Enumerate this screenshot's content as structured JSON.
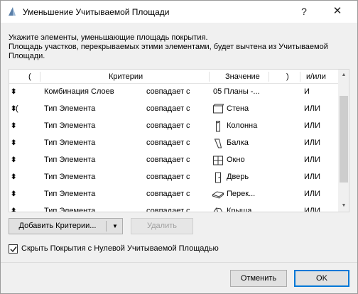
{
  "window": {
    "title": "Уменьшение Учитываемой Площади",
    "help_label": "?",
    "close_label": "✕"
  },
  "description": {
    "line1": "Укажите элементы, уменьшающие площадь покрытия.",
    "line2": "Площадь участков, перекрываемых этими элементами, будет вычтена из Учитываемой",
    "line3": "Площади."
  },
  "table": {
    "headers": {
      "open_paren": "(",
      "criteria": "Критерии",
      "value": "Значение",
      "close_paren": ")",
      "logic": "и/или"
    },
    "rows": [
      {
        "drag": "⬍",
        "paren": "",
        "criterion": "Комбинация Слоев",
        "operator": "совпадает с",
        "icon": "",
        "value": "05 Планы -...",
        "logic": "И"
      },
      {
        "drag": "⬍",
        "paren": "(",
        "criterion": "Тип Элемента",
        "operator": "совпадает с",
        "icon": "wall-icon",
        "value": "Стена",
        "logic": "ИЛИ"
      },
      {
        "drag": "⬍",
        "paren": "",
        "criterion": "Тип Элемента",
        "operator": "совпадает с",
        "icon": "column-icon",
        "value": "Колонна",
        "logic": "ИЛИ"
      },
      {
        "drag": "⬍",
        "paren": "",
        "criterion": "Тип Элемента",
        "operator": "совпадает с",
        "icon": "beam-icon",
        "value": "Балка",
        "logic": "ИЛИ"
      },
      {
        "drag": "⬍",
        "paren": "",
        "criterion": "Тип Элемента",
        "operator": "совпадает с",
        "icon": "window-icon",
        "value": "Окно",
        "logic": "ИЛИ"
      },
      {
        "drag": "⬍",
        "paren": "",
        "criterion": "Тип Элемента",
        "operator": "совпадает с",
        "icon": "door-icon",
        "value": "Дверь",
        "logic": "ИЛИ"
      },
      {
        "drag": "⬍",
        "paren": "",
        "criterion": "Тип Элемента",
        "operator": "совпадает с",
        "icon": "slab-icon",
        "value": "Перек...",
        "logic": "ИЛИ"
      },
      {
        "drag": "⬍",
        "paren": "",
        "criterion": "Тип Элемента",
        "operator": "совпадает с",
        "icon": "roof-icon",
        "value": "Крыша",
        "logic": "ИЛИ"
      },
      {
        "drag": "",
        "paren": "",
        "criterion": "",
        "operator": "",
        "icon": "shell-icon",
        "value": "",
        "logic": ""
      }
    ]
  },
  "buttons": {
    "add_criteria": "Добавить Критерии...",
    "delete": "Удалить",
    "cancel": "Отменить",
    "ok": "OK"
  },
  "checkbox": {
    "label": "Скрыть Покрытия с Нулевой Учитываемой Площадью",
    "checked": true
  },
  "colors": {
    "accent": "#0078d7",
    "window_bg": "#f0f0f0"
  }
}
